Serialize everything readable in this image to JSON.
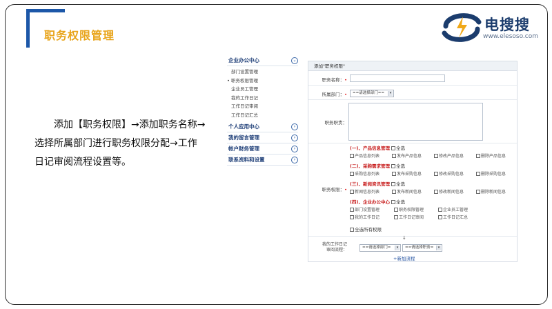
{
  "slide": {
    "title": "职务权限管理",
    "description": "添加【职务权限】→添加职务名称→选择所属部门进行职务权限分配→工作日记审阅流程设置等。"
  },
  "logo": {
    "name": "电搜搜",
    "url": "www.elesoso.com"
  },
  "sidebar": {
    "sections": [
      {
        "label": "企业办公中心",
        "icon": "chevron-down-icon",
        "items": [
          "部门设置管理",
          "职务权限管理",
          "企业员工管理",
          "我的工作日记",
          "工作日记审阅",
          "工作日记汇总"
        ]
      },
      {
        "label": "个人应用中心",
        "icon": "chevron-right-icon"
      },
      {
        "label": "我的留言管理",
        "icon": "chevron-right-icon"
      },
      {
        "label": "帐户财务管理",
        "icon": "chevron-right-icon"
      },
      {
        "label": "联系资料和设置",
        "icon": "chevron-right-icon"
      }
    ],
    "active_bullet": "•"
  },
  "form": {
    "header": "添加\"职务权限\"",
    "name_label": "职务名称：",
    "dept_label": "所属部门：",
    "dept_select": "==请选择部门==",
    "duty_label": "职务职责：",
    "perm_label": "职务权限：",
    "select_all": "全选",
    "groups": [
      {
        "name": "(一)、产品信息管理",
        "items": [
          "产品信息列表",
          "发布产品信息",
          "修改产品信息",
          "删除产品信息"
        ]
      },
      {
        "name": "(二)、采购需求管理",
        "items": [
          "采购信息列表",
          "发布采购信息",
          "修改采购信息",
          "删除采购信息"
        ]
      },
      {
        "name": "(三)、新闻资讯管理",
        "items": [
          "新闻信息列表",
          "发布新闻信息",
          "修改新闻信息",
          "删除新闻信息"
        ]
      },
      {
        "name": "(四)、企业办公中心",
        "items": [
          "部门设置管理",
          "职务权限管理",
          "企业员工管理",
          "我的工作日记",
          "工作日记审阅",
          "工作日记汇总"
        ]
      }
    ],
    "all_perms": "全选所有权限",
    "arrow": "↓",
    "review_label_1": "我的工作日记",
    "review_label_2": "审阅流程：",
    "review_dept_select": "==请选择部门=",
    "review_job_select": "==请选择职务=",
    "add_flow": "+新加流程",
    "required_mark": "•"
  },
  "colors": {
    "accent_blue": "#1c57a8",
    "title_orange": "#e8a41a",
    "group_red": "#c81f1f"
  }
}
